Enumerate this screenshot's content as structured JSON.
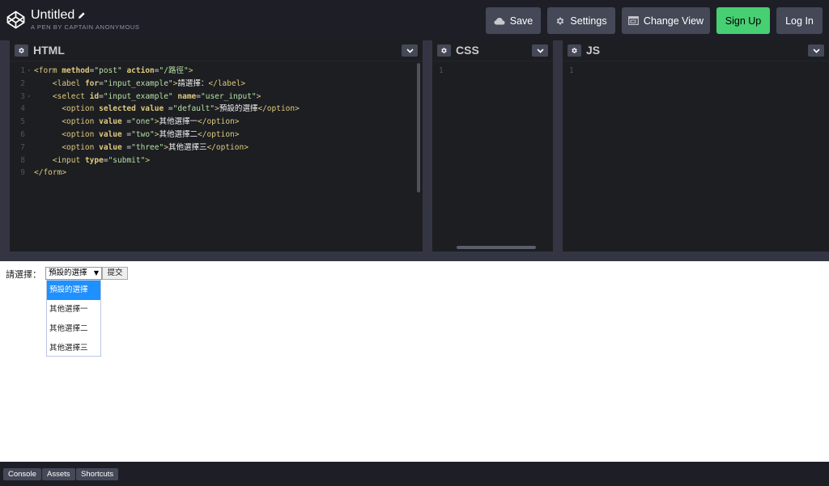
{
  "header": {
    "title": "Untitled",
    "subtitle": "A PEN BY CAPTAIN ANONYMOUS",
    "buttons": {
      "save": "Save",
      "settings": "Settings",
      "change_view": "Change View",
      "signup": "Sign Up",
      "login": "Log In"
    }
  },
  "editors": {
    "html": {
      "title": "HTML",
      "lines": [
        {
          "n": "1",
          "fold": true
        },
        {
          "n": "2",
          "fold": false
        },
        {
          "n": "3",
          "fold": true
        },
        {
          "n": "4",
          "fold": false
        },
        {
          "n": "5",
          "fold": false
        },
        {
          "n": "6",
          "fold": false
        },
        {
          "n": "7",
          "fold": false
        },
        {
          "n": "8",
          "fold": false
        },
        {
          "n": "9",
          "fold": false
        }
      ]
    },
    "css": {
      "title": "CSS",
      "line": "1"
    },
    "js": {
      "title": "JS",
      "line": "1"
    }
  },
  "result": {
    "label": "請選擇：",
    "select_value": "預設的選擇",
    "submit_label": "提交",
    "options": [
      "預設的選擇",
      "其他選擇一",
      "其他選擇二",
      "其他選擇三"
    ]
  },
  "footer": {
    "console": "Console",
    "assets": "Assets",
    "shortcuts": "Shortcuts"
  },
  "colors": {
    "accent_green": "#47cf73",
    "button_gray": "#444857",
    "selected_option": "#1e90ff"
  }
}
